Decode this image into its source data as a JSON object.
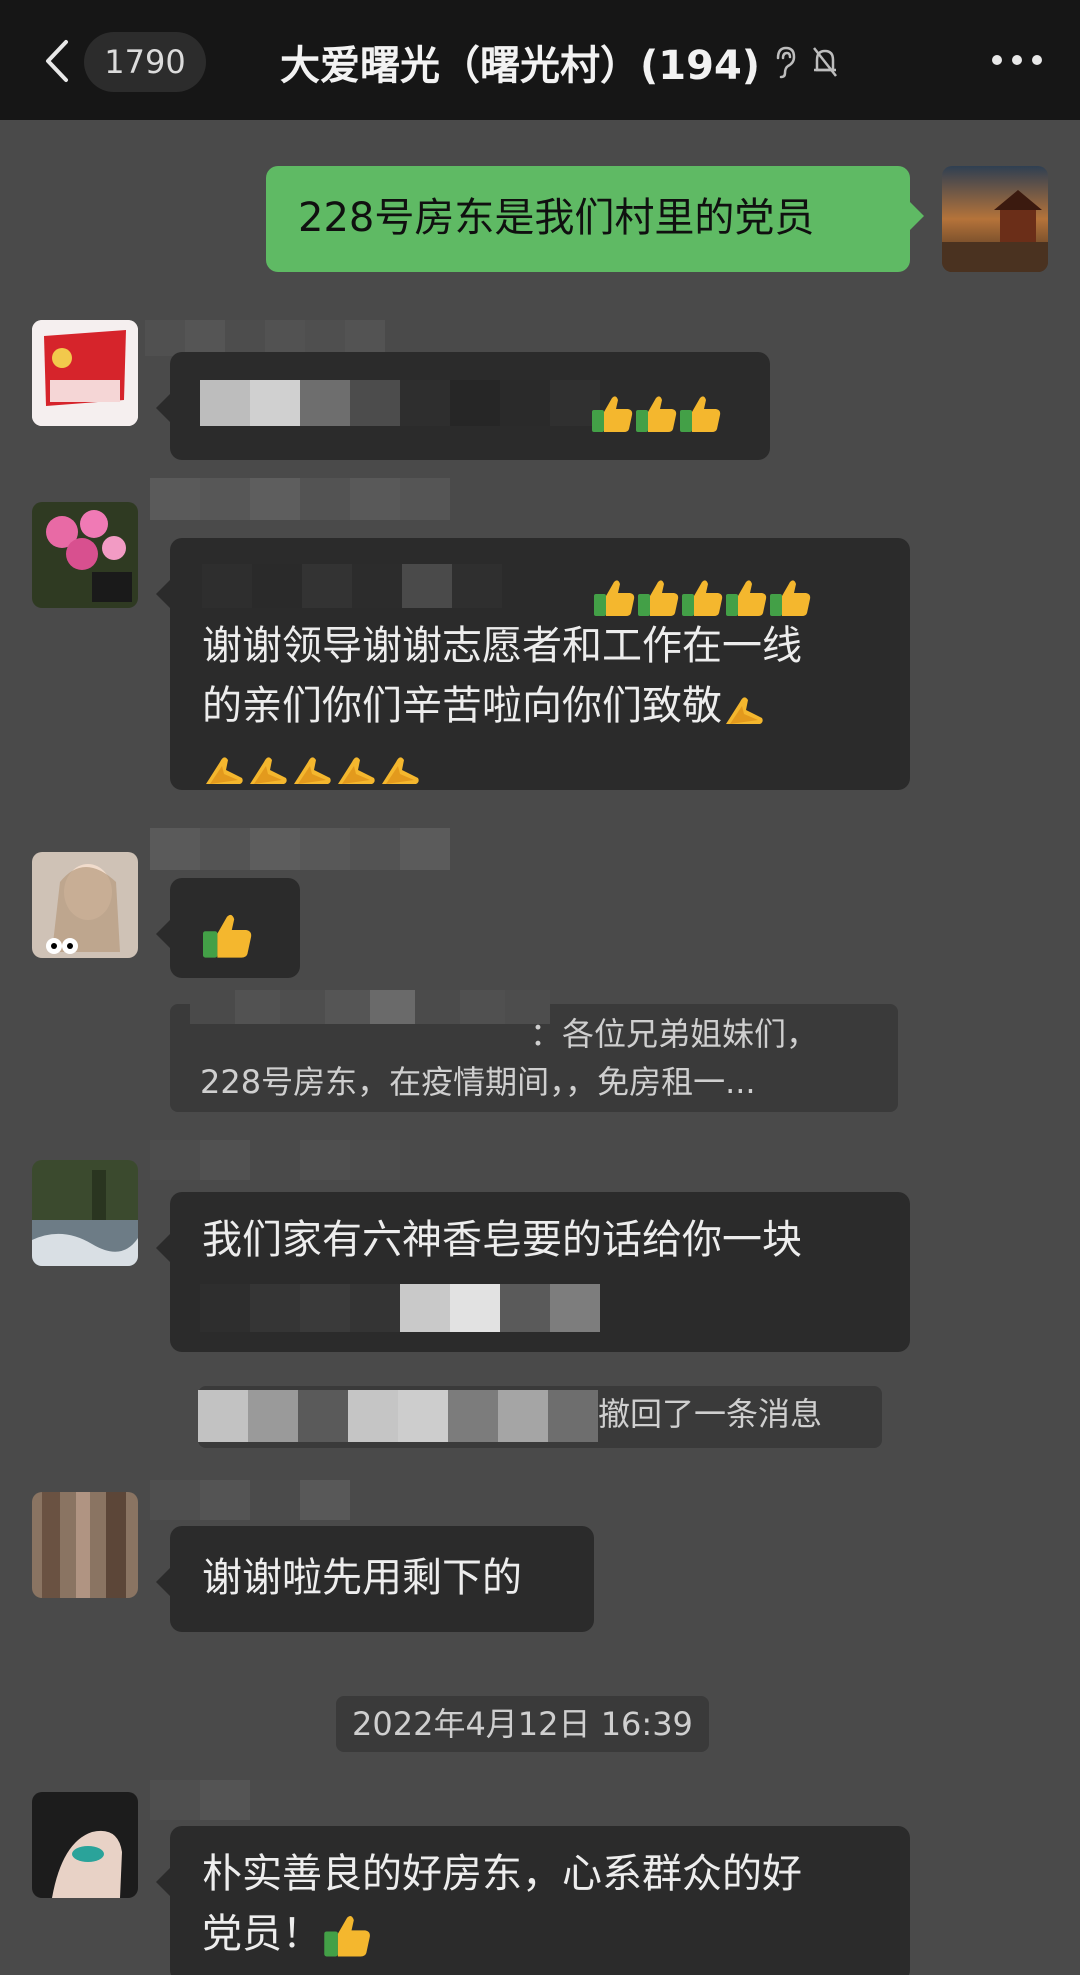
{
  "header": {
    "back_label": "",
    "unread_count": "1790",
    "title": "大爱曙光（曙光村）(194)"
  },
  "messages": {
    "m1_text": "228号房东是我们村里的党员",
    "m3_line1": "谢谢领导谢谢志愿者和工作在一线",
    "m3_line2": "的亲们你们辛苦啦向你们致敬",
    "quote_line1": "：各位兄弟姐妹们，",
    "quote_line2": "228号房东，在疫情期间，，免房租一...",
    "m5_text": "我们家有六神香皂要的话给你一块",
    "recall_text": "撤回了一条消息",
    "m6_text": "谢谢啦先用剩下的",
    "timestamp": "2022年4月12日 16:39",
    "m7_line1": "朴实善良的好房东，心系群众的好",
    "m7_line2": "党员！"
  },
  "colors": {
    "background": "#4a4a4a",
    "topbar": "#161616",
    "bubble_dark": "#2b2b2b",
    "bubble_mine": "#5fba64",
    "thumb_yellow": "#f4b72e",
    "thumb_green": "#43a047"
  },
  "icons": [
    "chevron-left-icon",
    "ear-icon",
    "bell-mute-icon",
    "more-dots-icon",
    "thumbs-up-icon",
    "pray-hands-icon"
  ]
}
